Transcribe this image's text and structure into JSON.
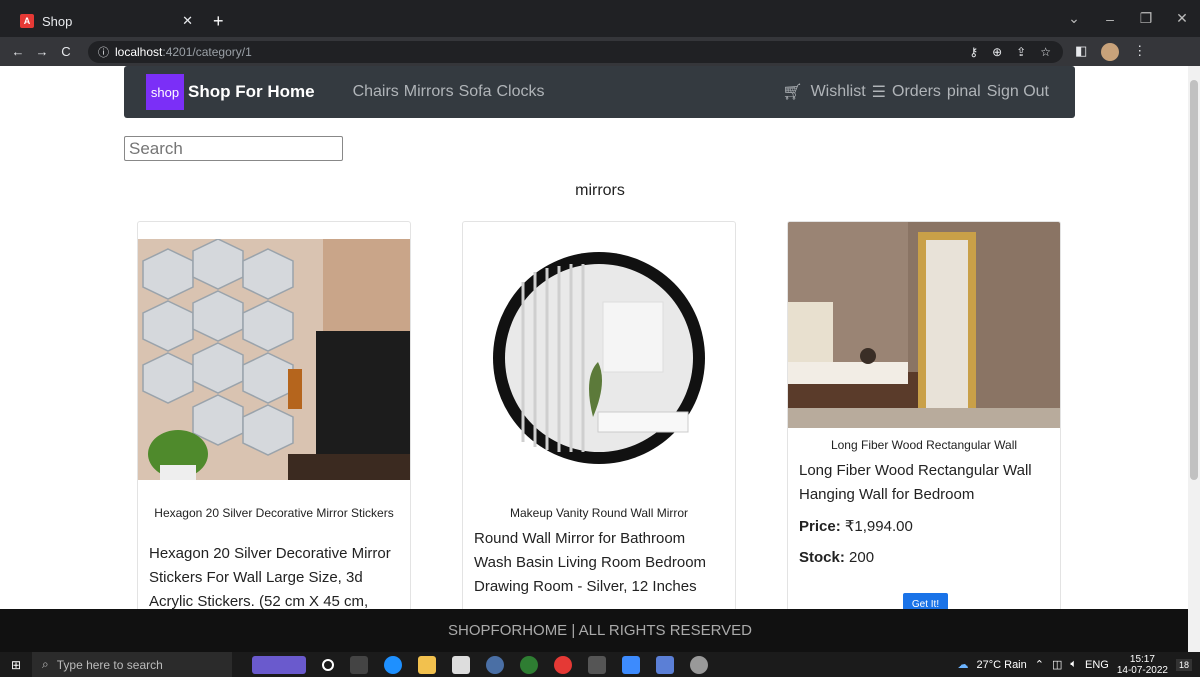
{
  "browser": {
    "tab_title": "Shop",
    "url_host": "localhost",
    "url_path": ":4201/category/1"
  },
  "navbar": {
    "brand_logo": "shop",
    "brand_name": "Shop For Home",
    "categories": [
      "Chairs",
      "Mirrors",
      "Sofa",
      "Clocks"
    ],
    "wishlist": "Wishlist",
    "orders": "Orders",
    "user": "pinal",
    "signout": "Sign Out"
  },
  "search": {
    "placeholder": "Search"
  },
  "category_title": "mirrors",
  "products": [
    {
      "name": "Hexagon 20 Silver Decorative Mirror Stickers",
      "desc": "Hexagon 20 Silver Decorative Mirror Stickers For Wall Large Size, 3d Acrylic Stickers. (52 cm X 45 cm,"
    },
    {
      "name": "Makeup Vanity Round Wall Mirror",
      "desc": "Round Wall Mirror for Bathroom Wash Basin Living Room Bedroom Drawing Room - Silver, 12 Inches"
    },
    {
      "name": "Long Fiber Wood Rectangular Wall",
      "desc": "Long Fiber Wood Rectangular Wall Hanging Wall for Bedroom",
      "price_label": "Price:",
      "price": "₹1,994.00",
      "stock_label": "Stock:",
      "stock": "200",
      "button": "Get It!"
    }
  ],
  "footer": "SHOPFORHOME | ALL RIGHTS RESERVED",
  "taskbar": {
    "search_placeholder": "Type here to search",
    "weather": "27°C Rain",
    "lang": "ENG",
    "time": "15:17",
    "date": "14-07-2022",
    "notif_count": "18"
  }
}
